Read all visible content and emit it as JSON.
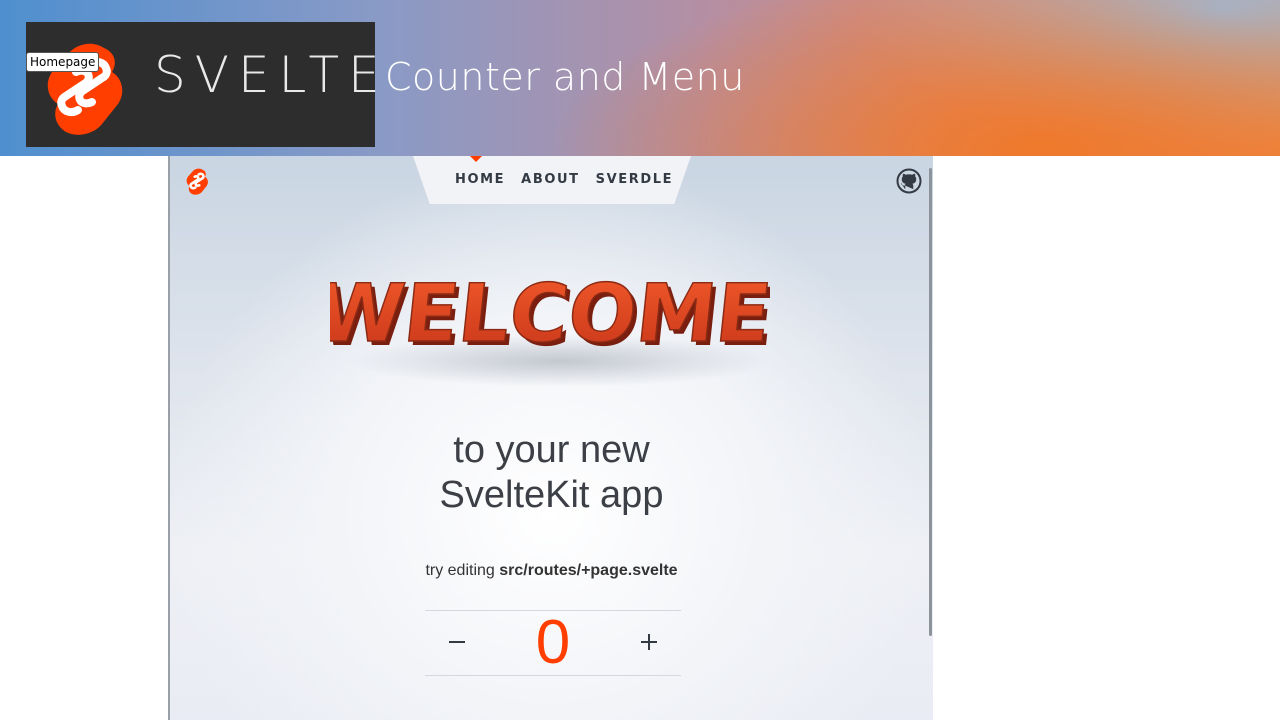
{
  "banner": {
    "logo_word": "SVELTE",
    "title": "Counter and Menu",
    "tooltip": "Homepage"
  },
  "app": {
    "nav": {
      "items": [
        {
          "label": "HOME",
          "active": true
        },
        {
          "label": "ABOUT",
          "active": false
        },
        {
          "label": "SVERDLE",
          "active": false
        }
      ]
    },
    "welcome_text": "WELCOME",
    "headline_line1": "to your new",
    "headline_line2": "SvelteKit app",
    "hint_prefix": "try editing ",
    "hint_file": "src/routes/+page.svelte",
    "counter": {
      "value": "0",
      "decrement_icon": "minus-icon",
      "increment_icon": "plus-icon"
    },
    "colors": {
      "accent": "#ff3e00",
      "text": "#3c3f45",
      "nav_bg": "#f1f3f6"
    }
  }
}
